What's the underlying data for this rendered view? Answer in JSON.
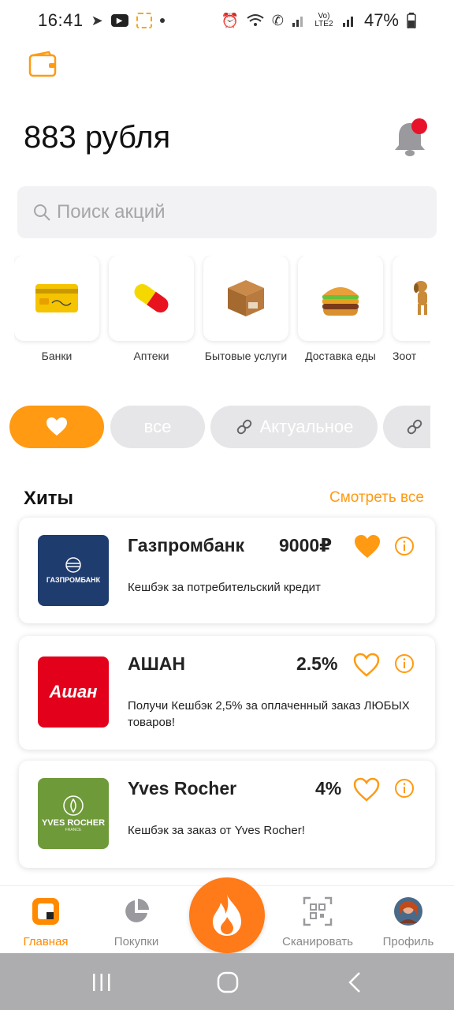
{
  "status_bar": {
    "time": "16:41",
    "network_label": "Vo) LTE2",
    "battery": "47%",
    "icons": [
      "telegram-icon",
      "youtube-icon",
      "scan-icon",
      "dot",
      "alarm-icon",
      "wifi-icon",
      "call-icon",
      "signal-icon",
      "battery-icon"
    ]
  },
  "header": {
    "balance": "883 рубля",
    "notification_badge": true
  },
  "search": {
    "placeholder": "Поиск акций"
  },
  "categories": [
    {
      "label": "Банки",
      "icon": "bank-card-icon"
    },
    {
      "label": "Аптеки",
      "icon": "pill-icon"
    },
    {
      "label": "Бытовые услуги",
      "icon": "box-icon"
    },
    {
      "label": "Доставка еды",
      "icon": "burger-icon"
    },
    {
      "label": "Зоот",
      "icon": "dog-icon"
    }
  ],
  "filters": {
    "favorites": "heart-icon",
    "all": "все",
    "actual": "Актуальное"
  },
  "section": {
    "title": "Хиты",
    "see_all": "Смотреть все"
  },
  "offers": [
    {
      "name": "Газпромбанк",
      "value": "9000₽",
      "description": "Кешбэк за потребительский кредит",
      "logo_text": "ГАЗПРОМБАНК",
      "logo_color": "#1f3c6e",
      "favorited": true
    },
    {
      "name": "АШАН",
      "value": "2.5%",
      "description": "Получи Кешбэк 2,5% за оплаченный заказ ЛЮБЫХ товаров!",
      "logo_text": "Ашан",
      "logo_color": "#e3001b",
      "favorited": false
    },
    {
      "name": "Yves Rocher",
      "value": "4%",
      "description": "Кешбэк за заказ от Yves Rocher!",
      "logo_text": "YVES ROCHER",
      "logo_subtext": "FRANCE",
      "logo_color": "#6f9a3a",
      "favorited": false
    }
  ],
  "bottom_nav": [
    {
      "label": "Главная",
      "icon": "home-icon",
      "active": true
    },
    {
      "label": "Покупки",
      "icon": "pie-chart-icon",
      "active": false
    },
    {
      "label": "Сканировать",
      "icon": "qr-scan-icon",
      "active": false
    },
    {
      "label": "Профиль",
      "icon": "avatar",
      "active": false
    }
  ],
  "colors": {
    "accent": "#ff9a12",
    "fab": "#ff7a18",
    "badge": "#e8132a"
  }
}
